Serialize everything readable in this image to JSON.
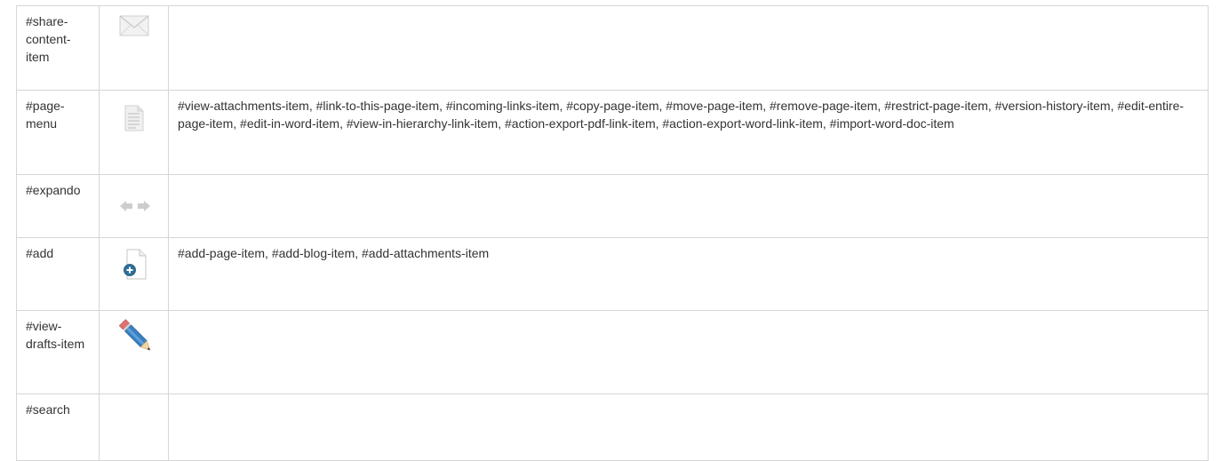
{
  "rows": [
    {
      "id": "#share-\ncontent-\nitem",
      "icon": "envelope-icon",
      "items": ""
    },
    {
      "id": "#page-\nmenu",
      "icon": "document-icon",
      "items": "#view-attachments-item, #link-to-this-page-item, #incoming-links-item, #copy-page-item, #move-page-item, #remove-page-item, #restrict-page-item, #version-history-item, #edit-entire-page-item, #edit-in-word-item, #view-in-hierarchy-link-item, #action-export-pdf-link-item, #action-export-word-link-item, #import-word-doc-item"
    },
    {
      "id": "#expando",
      "icon": "left-right-arrows-icon",
      "items": ""
    },
    {
      "id": "#add",
      "icon": "add-page-icon",
      "items": "#add-page-item, #add-blog-item, #add-attachments-item"
    },
    {
      "id": "#view-\ndrafts-item",
      "icon": "pencil-icon",
      "items": ""
    },
    {
      "id": "#search",
      "icon": "",
      "items": ""
    }
  ]
}
